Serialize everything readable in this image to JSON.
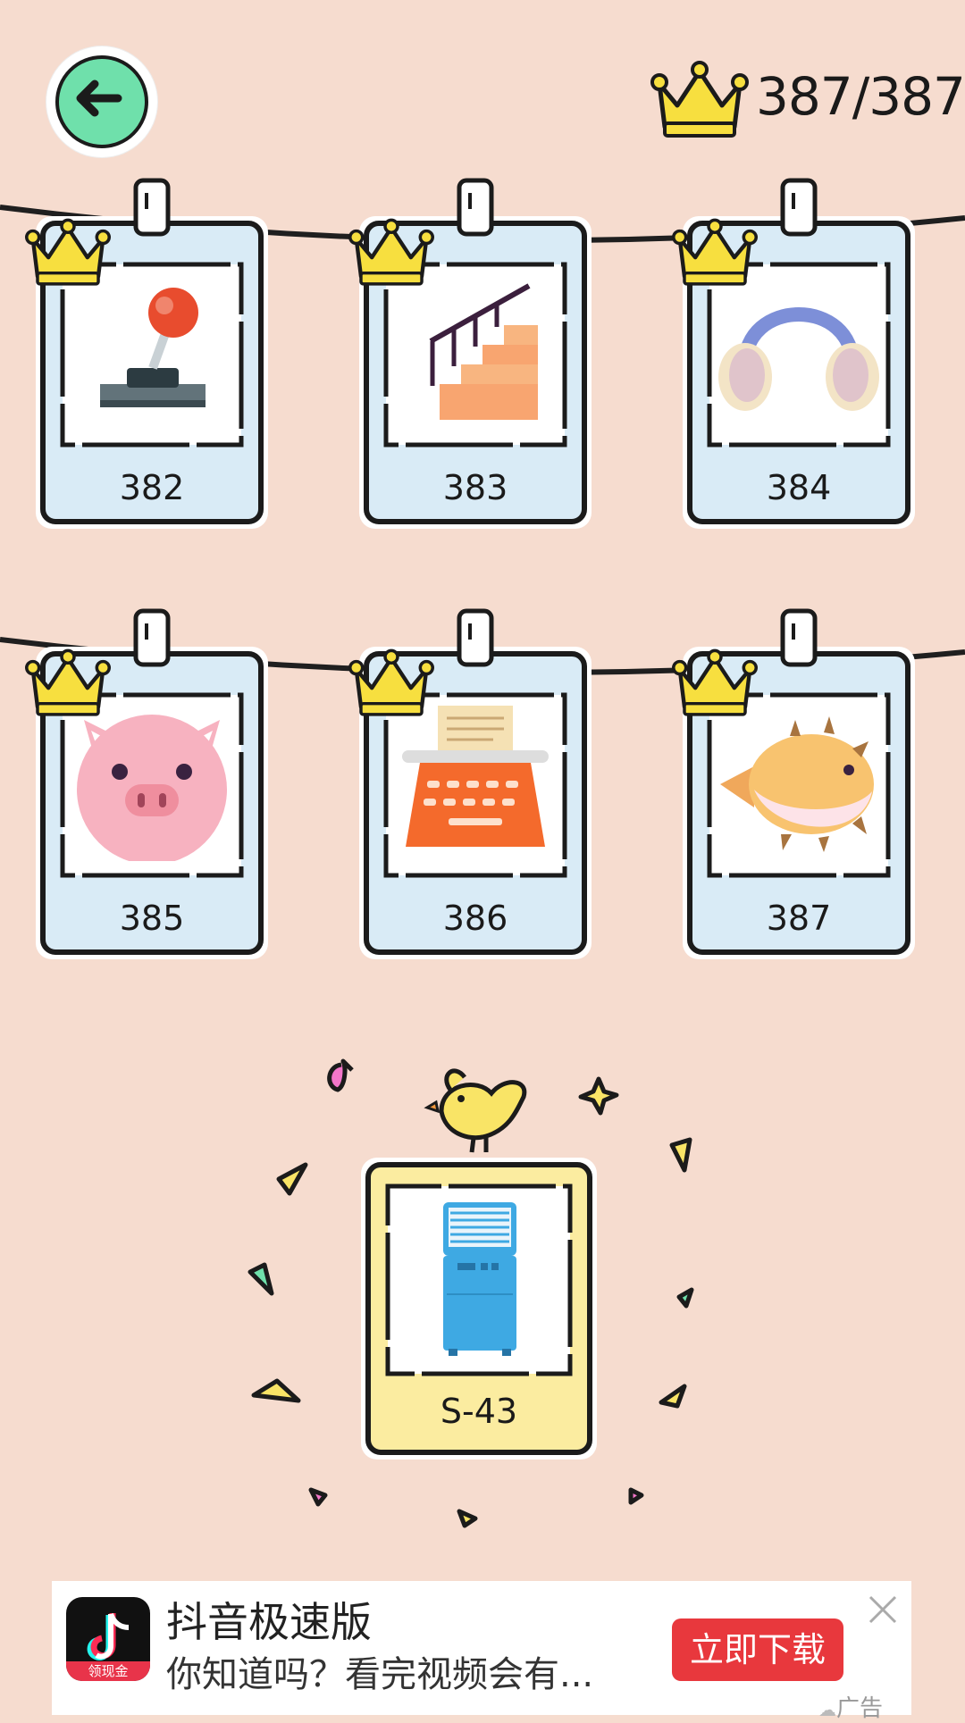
{
  "header": {
    "progress_text": "387/387",
    "back_icon": "arrow-left-icon"
  },
  "cards": [
    {
      "number": "382",
      "icon": "joystick-icon",
      "crowned": true
    },
    {
      "number": "383",
      "icon": "staircase-icon",
      "crowned": true
    },
    {
      "number": "384",
      "icon": "earmuffs-icon",
      "crowned": true
    },
    {
      "number": "385",
      "icon": "pig-icon",
      "crowned": true
    },
    {
      "number": "386",
      "icon": "typewriter-icon",
      "crowned": true
    },
    {
      "number": "387",
      "icon": "pufferfish-icon",
      "crowned": true
    }
  ],
  "reward": {
    "label": "S-43",
    "icon": "air-conditioner-icon",
    "mascot": "bird-icon"
  },
  "ad": {
    "title": "抖音极速版",
    "description": "你知道吗？看完视频会有...",
    "cta": "立即下载",
    "badge": "领现金",
    "tag": "广告"
  },
  "colors": {
    "background": "#f6dccf",
    "card_blue": "#d9ebf6",
    "card_yellow": "#fbeca0",
    "crown": "#f7df3f",
    "back_button": "#6fe0ab",
    "cta_red": "#e8383d"
  }
}
